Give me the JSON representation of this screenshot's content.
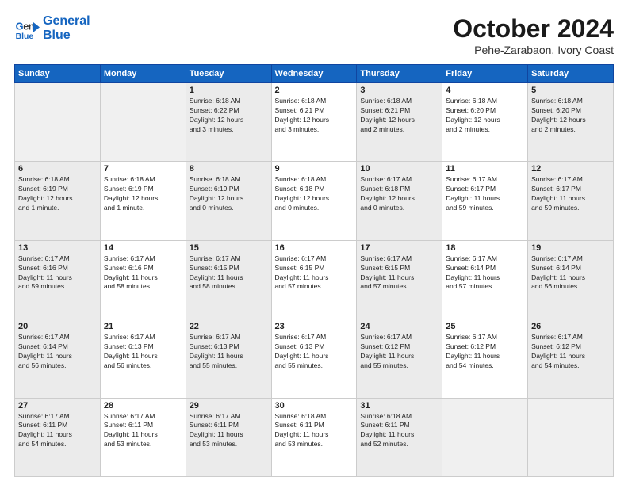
{
  "header": {
    "logo_line1": "General",
    "logo_line2": "Blue",
    "month": "October 2024",
    "location": "Pehe-Zarabaon, Ivory Coast"
  },
  "weekdays": [
    "Sunday",
    "Monday",
    "Tuesday",
    "Wednesday",
    "Thursday",
    "Friday",
    "Saturday"
  ],
  "rows": [
    [
      {
        "day": "",
        "info": ""
      },
      {
        "day": "",
        "info": ""
      },
      {
        "day": "1",
        "info": "Sunrise: 6:18 AM\nSunset: 6:22 PM\nDaylight: 12 hours\nand 3 minutes."
      },
      {
        "day": "2",
        "info": "Sunrise: 6:18 AM\nSunset: 6:21 PM\nDaylight: 12 hours\nand 3 minutes."
      },
      {
        "day": "3",
        "info": "Sunrise: 6:18 AM\nSunset: 6:21 PM\nDaylight: 12 hours\nand 2 minutes."
      },
      {
        "day": "4",
        "info": "Sunrise: 6:18 AM\nSunset: 6:20 PM\nDaylight: 12 hours\nand 2 minutes."
      },
      {
        "day": "5",
        "info": "Sunrise: 6:18 AM\nSunset: 6:20 PM\nDaylight: 12 hours\nand 2 minutes."
      }
    ],
    [
      {
        "day": "6",
        "info": "Sunrise: 6:18 AM\nSunset: 6:19 PM\nDaylight: 12 hours\nand 1 minute."
      },
      {
        "day": "7",
        "info": "Sunrise: 6:18 AM\nSunset: 6:19 PM\nDaylight: 12 hours\nand 1 minute."
      },
      {
        "day": "8",
        "info": "Sunrise: 6:18 AM\nSunset: 6:19 PM\nDaylight: 12 hours\nand 0 minutes."
      },
      {
        "day": "9",
        "info": "Sunrise: 6:18 AM\nSunset: 6:18 PM\nDaylight: 12 hours\nand 0 minutes."
      },
      {
        "day": "10",
        "info": "Sunrise: 6:17 AM\nSunset: 6:18 PM\nDaylight: 12 hours\nand 0 minutes."
      },
      {
        "day": "11",
        "info": "Sunrise: 6:17 AM\nSunset: 6:17 PM\nDaylight: 11 hours\nand 59 minutes."
      },
      {
        "day": "12",
        "info": "Sunrise: 6:17 AM\nSunset: 6:17 PM\nDaylight: 11 hours\nand 59 minutes."
      }
    ],
    [
      {
        "day": "13",
        "info": "Sunrise: 6:17 AM\nSunset: 6:16 PM\nDaylight: 11 hours\nand 59 minutes."
      },
      {
        "day": "14",
        "info": "Sunrise: 6:17 AM\nSunset: 6:16 PM\nDaylight: 11 hours\nand 58 minutes."
      },
      {
        "day": "15",
        "info": "Sunrise: 6:17 AM\nSunset: 6:15 PM\nDaylight: 11 hours\nand 58 minutes."
      },
      {
        "day": "16",
        "info": "Sunrise: 6:17 AM\nSunset: 6:15 PM\nDaylight: 11 hours\nand 57 minutes."
      },
      {
        "day": "17",
        "info": "Sunrise: 6:17 AM\nSunset: 6:15 PM\nDaylight: 11 hours\nand 57 minutes."
      },
      {
        "day": "18",
        "info": "Sunrise: 6:17 AM\nSunset: 6:14 PM\nDaylight: 11 hours\nand 57 minutes."
      },
      {
        "day": "19",
        "info": "Sunrise: 6:17 AM\nSunset: 6:14 PM\nDaylight: 11 hours\nand 56 minutes."
      }
    ],
    [
      {
        "day": "20",
        "info": "Sunrise: 6:17 AM\nSunset: 6:14 PM\nDaylight: 11 hours\nand 56 minutes."
      },
      {
        "day": "21",
        "info": "Sunrise: 6:17 AM\nSunset: 6:13 PM\nDaylight: 11 hours\nand 56 minutes."
      },
      {
        "day": "22",
        "info": "Sunrise: 6:17 AM\nSunset: 6:13 PM\nDaylight: 11 hours\nand 55 minutes."
      },
      {
        "day": "23",
        "info": "Sunrise: 6:17 AM\nSunset: 6:13 PM\nDaylight: 11 hours\nand 55 minutes."
      },
      {
        "day": "24",
        "info": "Sunrise: 6:17 AM\nSunset: 6:12 PM\nDaylight: 11 hours\nand 55 minutes."
      },
      {
        "day": "25",
        "info": "Sunrise: 6:17 AM\nSunset: 6:12 PM\nDaylight: 11 hours\nand 54 minutes."
      },
      {
        "day": "26",
        "info": "Sunrise: 6:17 AM\nSunset: 6:12 PM\nDaylight: 11 hours\nand 54 minutes."
      }
    ],
    [
      {
        "day": "27",
        "info": "Sunrise: 6:17 AM\nSunset: 6:11 PM\nDaylight: 11 hours\nand 54 minutes."
      },
      {
        "day": "28",
        "info": "Sunrise: 6:17 AM\nSunset: 6:11 PM\nDaylight: 11 hours\nand 53 minutes."
      },
      {
        "day": "29",
        "info": "Sunrise: 6:17 AM\nSunset: 6:11 PM\nDaylight: 11 hours\nand 53 minutes."
      },
      {
        "day": "30",
        "info": "Sunrise: 6:18 AM\nSunset: 6:11 PM\nDaylight: 11 hours\nand 53 minutes."
      },
      {
        "day": "31",
        "info": "Sunrise: 6:18 AM\nSunset: 6:11 PM\nDaylight: 11 hours\nand 52 minutes."
      },
      {
        "day": "",
        "info": ""
      },
      {
        "day": "",
        "info": ""
      }
    ]
  ]
}
